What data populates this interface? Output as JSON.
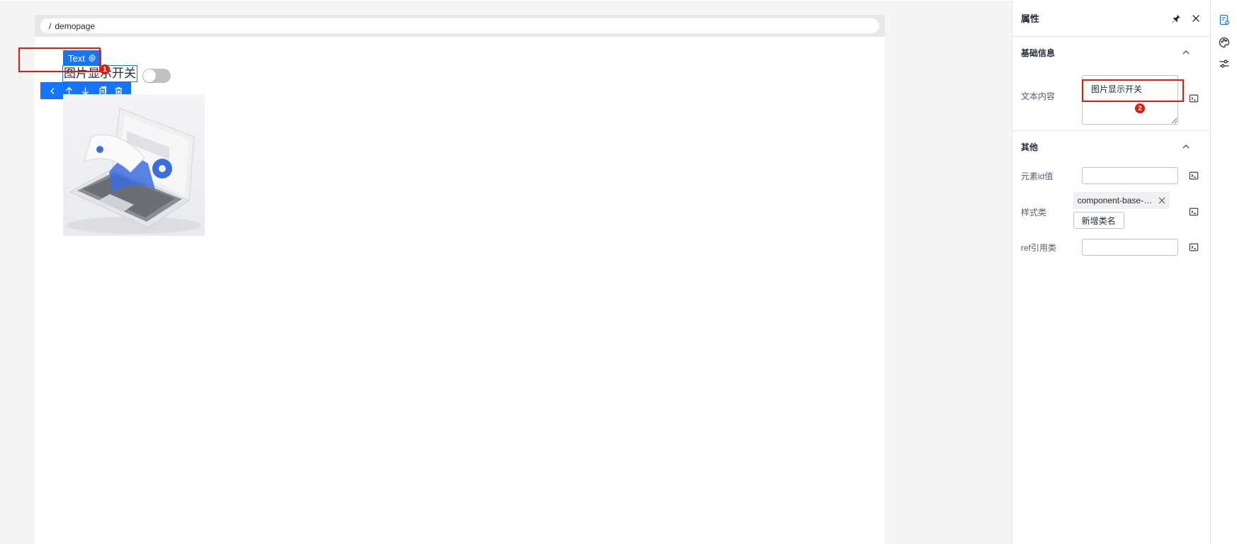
{
  "canvas": {
    "breadcrumb": {
      "separator": "/",
      "page": "demopage"
    },
    "selected_component": {
      "tag_label": "Text",
      "text": "图片显示开关",
      "marker": "1"
    },
    "switch": {
      "checked": false
    },
    "toolbar": {
      "icons": [
        "chevron-left-icon",
        "arrow-up-icon",
        "arrow-down-icon",
        "copy-icon",
        "delete-icon"
      ]
    },
    "image": {
      "icon": "laptop-settings-illustration"
    }
  },
  "panel": {
    "title": "属性",
    "sections": {
      "basic": {
        "title": "基础信息",
        "text_content_label": "文本内容",
        "text_content_value": "图片显示开关",
        "marker": "2"
      },
      "other": {
        "title": "其他",
        "element_id_label": "元素id值",
        "element_id_value": "",
        "style_class_label": "样式类",
        "style_class_tag": "component-base-s...",
        "add_class_label": "新增类名",
        "ref_label": "ref引用类",
        "ref_value": ""
      }
    }
  },
  "colors": {
    "accent": "#1476ff",
    "highlight": "#e8170b"
  }
}
